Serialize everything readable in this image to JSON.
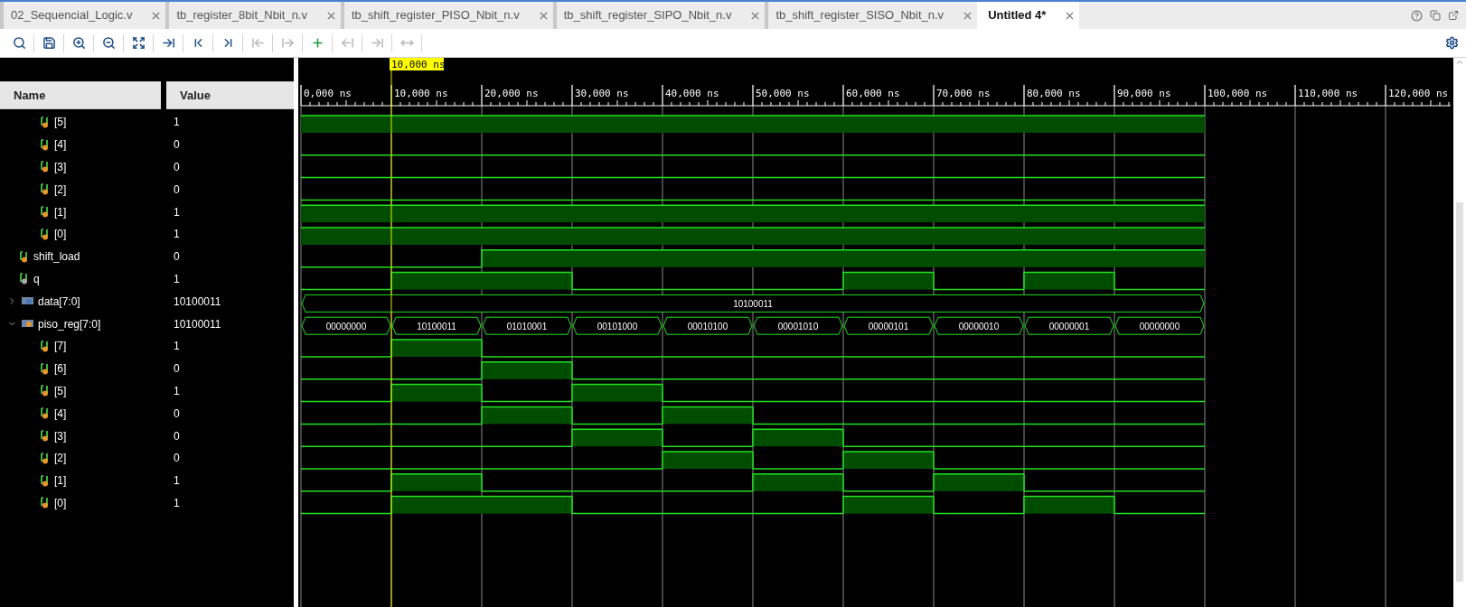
{
  "tabs": [
    {
      "label": "02_Sequencial_Logic.v",
      "selected": false
    },
    {
      "label": "tb_register_8bit_Nbit_n.v",
      "selected": false
    },
    {
      "label": "tb_shift_register_PISO_Nbit_n.v",
      "selected": false
    },
    {
      "label": "tb_shift_register_SIPO_Nbit_n.v",
      "selected": false
    },
    {
      "label": "tb_shift_register_SISO_Nbit_n.v",
      "selected": false
    },
    {
      "label": "Untitled 4*",
      "selected": true
    }
  ],
  "toolbar": [
    {
      "kind": "search",
      "disabled": false
    },
    {
      "kind": "save",
      "disabled": false
    },
    {
      "kind": "zoom_in",
      "disabled": false
    },
    {
      "kind": "zoom_out",
      "disabled": false
    },
    {
      "kind": "fit",
      "disabled": false
    },
    {
      "kind": "to_cursor",
      "disabled": false
    },
    {
      "kind": "first",
      "disabled": false
    },
    {
      "kind": "last",
      "disabled": false
    },
    {
      "kind": "prev_edge",
      "disabled": true
    },
    {
      "kind": "next_edge",
      "disabled": true
    },
    {
      "kind": "add_marker",
      "disabled": false
    },
    {
      "kind": "prev_marker",
      "disabled": true
    },
    {
      "kind": "next_marker",
      "disabled": true
    },
    {
      "kind": "swap",
      "disabled": true
    }
  ],
  "columns": {
    "name": "Name",
    "value": "Value"
  },
  "ruler": {
    "cursor": "10,000 ns",
    "labels": [
      "0,000 ns",
      "10,000 ns",
      "20,000 ns",
      "30,000 ns",
      "40,000 ns",
      "50,000 ns",
      "60,000 ns",
      "70,000 ns",
      "80,000 ns",
      "90,000 ns",
      "100,000 ns",
      "110,000 ns",
      "120,000 ns"
    ]
  },
  "upper_children": [
    {
      "kind": "bit",
      "name": "[5]",
      "value": "1",
      "color": "#e8962a",
      "high": [
        true,
        true,
        true,
        true,
        true,
        true,
        true,
        true,
        true,
        true
      ]
    },
    {
      "kind": "bit",
      "name": "[4]",
      "value": "0",
      "color": "#e8962a",
      "high": [
        false,
        false,
        false,
        false,
        false,
        false,
        false,
        false,
        false,
        false
      ]
    },
    {
      "kind": "bit",
      "name": "[3]",
      "value": "0",
      "color": "#e8962a",
      "high": [
        false,
        false,
        false,
        false,
        false,
        false,
        false,
        false,
        false,
        false
      ]
    },
    {
      "kind": "bit",
      "name": "[2]",
      "value": "0",
      "color": "#e8962a",
      "high": [
        false,
        false,
        false,
        false,
        false,
        false,
        false,
        false,
        false,
        false
      ]
    },
    {
      "kind": "bit",
      "name": "[1]",
      "value": "1",
      "color": "#e8962a",
      "high": [
        true,
        true,
        true,
        true,
        true,
        true,
        true,
        true,
        true,
        true
      ]
    },
    {
      "kind": "bit",
      "name": "[0]",
      "value": "1",
      "color": "#e8962a",
      "high": [
        true,
        true,
        true,
        true,
        true,
        true,
        true,
        true,
        true,
        true
      ]
    }
  ],
  "signals": [
    {
      "kind": "bit",
      "name": "shift_load",
      "value": "0",
      "color": "#e8962a",
      "high": [
        false,
        false,
        true,
        true,
        true,
        true,
        true,
        true,
        true,
        true
      ]
    },
    {
      "kind": "bit",
      "name": "q",
      "value": "1",
      "color": "#a8a8a8",
      "high": [
        false,
        true,
        true,
        false,
        false,
        false,
        true,
        false,
        true,
        false
      ]
    },
    {
      "kind": "bus",
      "name": "data[7:0]",
      "value": "10100011",
      "color": "#4a78b8",
      "expanded": false,
      "segments": [
        "10100011"
      ]
    },
    {
      "kind": "bus",
      "name": "piso_reg[7:0]",
      "value": "10100011",
      "color": "#e8962a",
      "expanded": true,
      "segments": [
        "00000000",
        "10100011",
        "01010001",
        "00101000",
        "00010100",
        "00001010",
        "00000101",
        "00000010",
        "00000001",
        "00000000"
      ],
      "children": [
        {
          "kind": "bit",
          "name": "[7]",
          "value": "1",
          "color": "#e8962a",
          "high": [
            false,
            true,
            false,
            false,
            false,
            false,
            false,
            false,
            false,
            false
          ]
        },
        {
          "kind": "bit",
          "name": "[6]",
          "value": "0",
          "color": "#e8962a",
          "high": [
            false,
            false,
            true,
            false,
            false,
            false,
            false,
            false,
            false,
            false
          ]
        },
        {
          "kind": "bit",
          "name": "[5]",
          "value": "1",
          "color": "#e8962a",
          "high": [
            false,
            true,
            false,
            true,
            false,
            false,
            false,
            false,
            false,
            false
          ]
        },
        {
          "kind": "bit",
          "name": "[4]",
          "value": "0",
          "color": "#e8962a",
          "high": [
            false,
            false,
            true,
            false,
            true,
            false,
            false,
            false,
            false,
            false
          ]
        },
        {
          "kind": "bit",
          "name": "[3]",
          "value": "0",
          "color": "#e8962a",
          "high": [
            false,
            false,
            false,
            true,
            false,
            true,
            false,
            false,
            false,
            false
          ]
        },
        {
          "kind": "bit",
          "name": "[2]",
          "value": "0",
          "color": "#e8962a",
          "high": [
            false,
            false,
            false,
            false,
            true,
            false,
            true,
            false,
            false,
            false
          ]
        },
        {
          "kind": "bit",
          "name": "[1]",
          "value": "1",
          "color": "#e8962a",
          "high": [
            false,
            true,
            false,
            false,
            false,
            true,
            false,
            true,
            false,
            false
          ]
        },
        {
          "kind": "bit",
          "name": "[0]",
          "value": "1",
          "color": "#e8962a",
          "high": [
            false,
            true,
            true,
            false,
            false,
            false,
            true,
            false,
            true,
            false
          ]
        }
      ]
    }
  ]
}
